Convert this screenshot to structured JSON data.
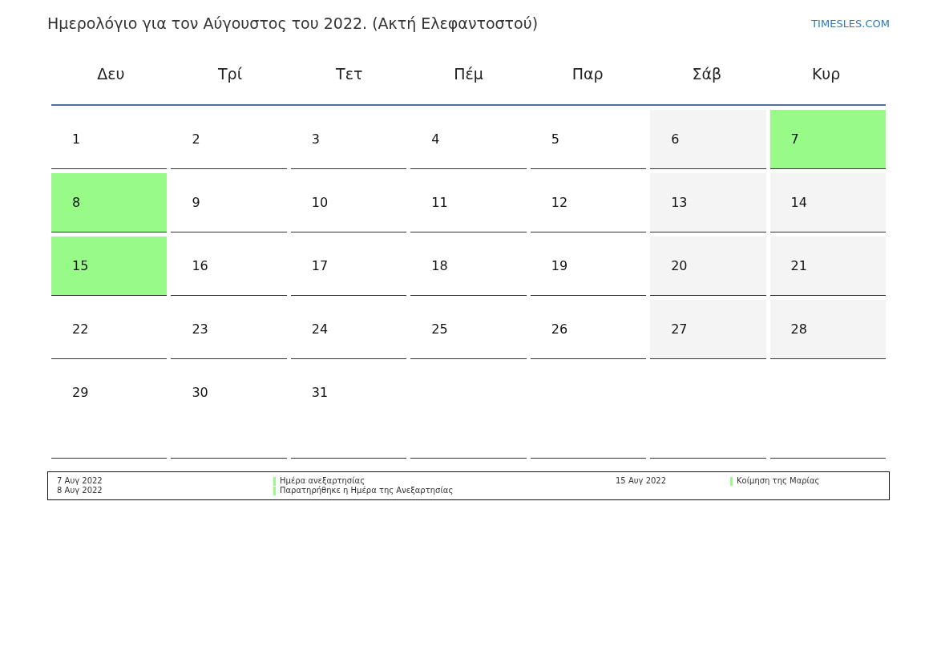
{
  "title": "Ημερολόγιο για τον Αύγουστος του 2022. (Ακτή Ελεφαντοστού)",
  "site_link": "TIMESLES.COM",
  "weekdays": [
    "Δευ",
    "Τρί",
    "Τετ",
    "Πέμ",
    "Παρ",
    "Σάβ",
    "Κυρ"
  ],
  "weeks": [
    [
      {
        "day": "1",
        "color": "#ffffff"
      },
      {
        "day": "2",
        "color": "#ffffff"
      },
      {
        "day": "3",
        "color": "#ffffff"
      },
      {
        "day": "4",
        "color": "#ffffff"
      },
      {
        "day": "5",
        "color": "#ffffff"
      },
      {
        "day": "6",
        "color": "#f4f4f4"
      },
      {
        "day": "7",
        "color": "#98fb88"
      }
    ],
    [
      {
        "day": "8",
        "color": "#98fb88"
      },
      {
        "day": "9",
        "color": "#ffffff"
      },
      {
        "day": "10",
        "color": "#ffffff"
      },
      {
        "day": "11",
        "color": "#ffffff"
      },
      {
        "day": "12",
        "color": "#ffffff"
      },
      {
        "day": "13",
        "color": "#f4f4f4"
      },
      {
        "day": "14",
        "color": "#f4f4f4"
      }
    ],
    [
      {
        "day": "15",
        "color": "#98fb88"
      },
      {
        "day": "16",
        "color": "#ffffff"
      },
      {
        "day": "17",
        "color": "#ffffff"
      },
      {
        "day": "18",
        "color": "#ffffff"
      },
      {
        "day": "19",
        "color": "#ffffff"
      },
      {
        "day": "20",
        "color": "#f4f4f4"
      },
      {
        "day": "21",
        "color": "#f4f4f4"
      }
    ],
    [
      {
        "day": "22",
        "color": "#ffffff"
      },
      {
        "day": "23",
        "color": "#ffffff"
      },
      {
        "day": "24",
        "color": "#ffffff"
      },
      {
        "day": "25",
        "color": "#ffffff"
      },
      {
        "day": "26",
        "color": "#ffffff"
      },
      {
        "day": "27",
        "color": "#f4f4f4"
      },
      {
        "day": "28",
        "color": "#f4f4f4"
      }
    ],
    [
      {
        "day": "29",
        "color": "#ffffff"
      },
      {
        "day": "30",
        "color": "#ffffff"
      },
      {
        "day": "31",
        "color": "#ffffff"
      }
    ]
  ],
  "legend": [
    [
      {
        "date": "7 Αυγ 2022",
        "name": "Ημέρα ανεξαρτησίας",
        "color": "#98fb88"
      },
      {
        "date": "8 Αυγ 2022",
        "name": "Παρατηρήθηκε η Ημέρα της Ανεξαρτησίας",
        "color": "#98fb88"
      }
    ],
    [
      {
        "date": "15 Αυγ 2022",
        "name": "Κοίμηση της Μαρίας",
        "color": "#98fb88"
      }
    ]
  ]
}
